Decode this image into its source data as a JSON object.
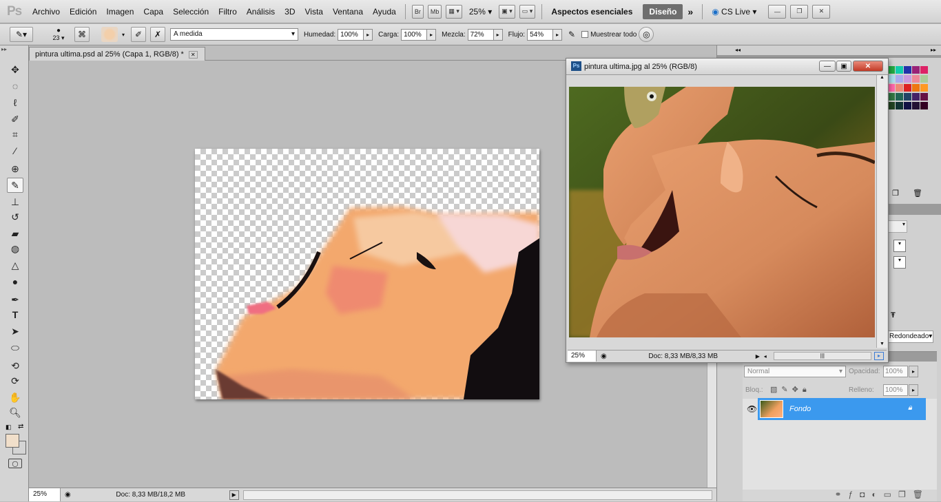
{
  "menubar": {
    "items": [
      "Archivo",
      "Edición",
      "Imagen",
      "Capa",
      "Selección",
      "Filtro",
      "Análisis",
      "3D",
      "Vista",
      "Ventana",
      "Ayuda"
    ],
    "bridge": "Br",
    "minibridge": "Mb",
    "zoom": "25%",
    "workspace": "Aspectos esenciales",
    "design": "Diseño",
    "cslive": "CS Live"
  },
  "options": {
    "brush_size": "23",
    "preset": "A medida",
    "humidity_label": "Humedad:",
    "humidity": "100%",
    "load_label": "Carga:",
    "load": "100%",
    "mix_label": "Mezcla:",
    "mix": "72%",
    "flow_label": "Flujo:",
    "flow": "54%",
    "sample_all": "Muestrear todo"
  },
  "document": {
    "tab": "pintura ultima.psd al 25% (Capa 1, RGB/8) *",
    "zoom": "25%",
    "doc_info": "Doc: 8,33 MB/18,2 MB"
  },
  "floating": {
    "title": "pintura ultima.jpg al 25% (RGB/8)",
    "zoom": "25%",
    "doc_info": "Doc: 8,33 MB/8,33 MB"
  },
  "right": {
    "brush_shape": "Redondeado"
  },
  "layers": {
    "blend": "Normal",
    "opacity_label": "Opacidad:",
    "opacity": "100%",
    "lock_label": "Bloq.:",
    "fill_label": "Relleno:",
    "fill": "100%",
    "layer_name": "Fondo"
  },
  "colors": {
    "foreground": "#f1dfca",
    "background": "#ffffff",
    "accent": "#3b99ee"
  },
  "swatch_colors": [
    "#22aa44",
    "#11ccaa",
    "#2233aa",
    "#992277",
    "#dd2266",
    "#aaddee",
    "#aaaaee",
    "#cc99dd",
    "#ee8899",
    "#aacc99",
    "#ff66aa",
    "#ee8877",
    "#dd2222",
    "#ee7711",
    "#ff9922",
    "#337744",
    "#226655",
    "#224466",
    "#442266",
    "#661144",
    "#224422",
    "#113333",
    "#111144",
    "#221133",
    "#330022"
  ]
}
